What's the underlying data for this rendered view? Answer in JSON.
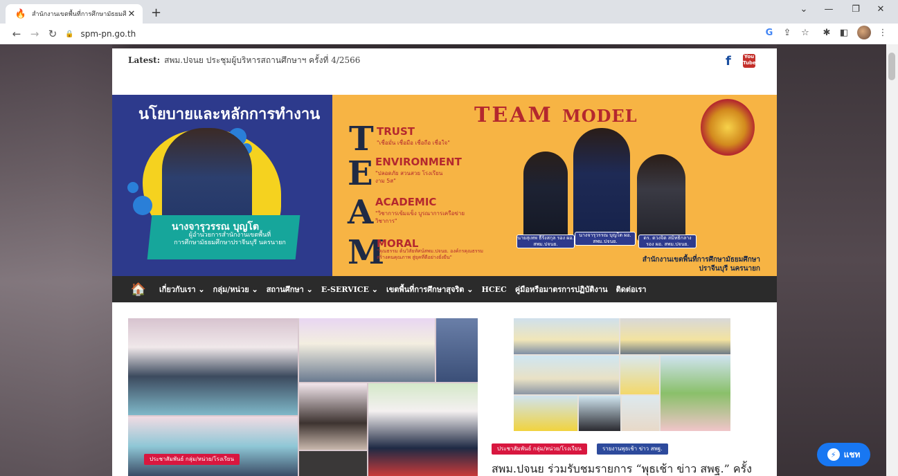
{
  "browser": {
    "tab_title": "สำนักงานเขตพื้นที่การศึกษามัธยมศึกษ",
    "tab_close": "✕",
    "new_tab": "+",
    "url": "spm-pn.go.th",
    "window_controls": [
      "⌄",
      "—",
      "❐",
      "✕"
    ]
  },
  "topbar": {
    "latest_label": "Latest:",
    "latest_text": "สพม.ปจนย ประชุมผู้บริหารสถานศึกษาฯ ครั้งที่ 4/2566",
    "facebook": "f",
    "youtube": "You Tube"
  },
  "banner": {
    "heading": "นโยบายและหลักการทำงาน",
    "name": "นางจารุวรรณ บุญโต",
    "subtitle_1": "ผู้อำนวยการสำนักงานเขตพื้นที่",
    "subtitle_2": "การศึกษามัธยมศึกษาปราจีนบุรี นครนายก",
    "team": "TEAM",
    "model": "MODEL",
    "values": [
      {
        "letter": "T",
        "head": "TRUST",
        "sub": "\"เชื่อมั่น เชื่อมือ เชื่อถือ เชื่อใจ\""
      },
      {
        "letter": "E",
        "head": "ENVIRONMENT",
        "sub": "\"ปลอดภัย สวนสวย โรงเรียนงาม 5ส\""
      },
      {
        "letter": "A",
        "head": "ACADEMIC",
        "sub": "\"วิชาการเข้มแข็ง บูรณาการเครือข่ายวิชาการ\""
      },
      {
        "letter": "M",
        "head": "MORAL",
        "sub": "\"คุณธรรม ต้นวิสัยทัศน์สพม.ปจนย. องค์กรคุณธรรม สร้างคนคุณภาพ สู่ยุคที่ดีอย่างยั่งยืน\""
      }
    ],
    "captions": [
      "นายสุเทพ ธีรังสกุล รอง ผอ. สพม.ปจนย.",
      "นางจารุวรรณ บุญโต ผอ. สพม.ปจนย.",
      "ดร. ดวงจิต สมิทธิกลาง รอง ผอ. สพม.ปจนย."
    ],
    "office_1": "สำนักงานเขตพื้นที่การศึกษามัธยมศึกษา",
    "office_2": "ปราจีนบุรี นครนายก"
  },
  "nav": {
    "items": [
      "เกี่ยวกับเรา ⌄",
      "กลุ่ม/หน่วย ⌄",
      "สถานศึกษา ⌄",
      "E-SERVICE ⌄",
      "เขตพื้นที่การศึกษาสุจริต ⌄",
      "HCEC",
      "คู่มือหรือมาตรการปฏิบัติงาน",
      "ติดต่อเรา"
    ]
  },
  "content": {
    "left_tag": "ประชาสัมพันธ์ กลุ่ม/หน่วย/โรงเรียน",
    "right_tag_1": "ประชาสัมพันธ์ กลุ่ม/หน่วย/โรงเรียน",
    "right_tag_2": "รายงานพุธเช้า ข่าว สพฐ.",
    "headline": "สพม.ปจนย ร่วมรับชมรายการ “พุธเช้า ข่าว สพฐ.” ครั้ง"
  },
  "chat": {
    "label": "แชท"
  },
  "colors": {
    "nav_bg": "#2b2b2b",
    "tag_red": "#d8173f",
    "tag_blue": "#2d4a9c",
    "chat_blue": "#1877f2"
  }
}
